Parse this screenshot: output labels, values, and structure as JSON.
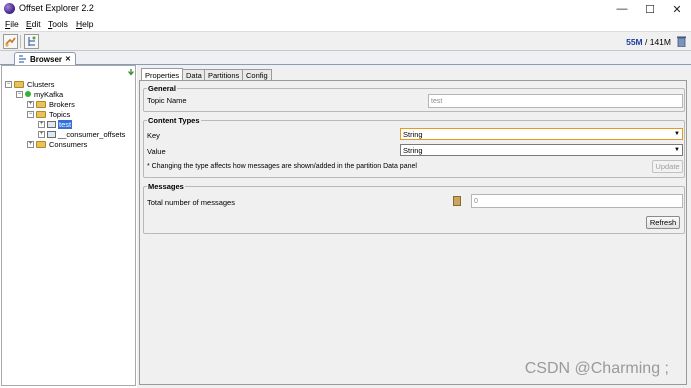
{
  "window": {
    "title": "Offset Explorer  2.2",
    "minimize": "—",
    "maximize": "☐",
    "close": "✕"
  },
  "menu": {
    "items": [
      {
        "accel": "F",
        "rest": "ile"
      },
      {
        "accel": "E",
        "rest": "dit"
      },
      {
        "accel": "T",
        "rest": "ools"
      },
      {
        "accel": "H",
        "rest": "elp"
      }
    ]
  },
  "toolbar": {
    "mem_used": "55M",
    "mem_total": " / 141M"
  },
  "browser_tab": {
    "label": "Browser",
    "close": "✕"
  },
  "tree": {
    "clusters": "Clusters",
    "cluster": "myKafka",
    "brokers": "Brokers",
    "topics": "Topics",
    "topic_selected": "test",
    "topic_other": "__consumer_offsets",
    "consumers": "Consumers",
    "expand_minus": "−",
    "expand_plus": "+"
  },
  "tabs": [
    "Properties",
    "Data",
    "Partitions",
    "Config"
  ],
  "general": {
    "legend": "General",
    "topic_name_label": "Topic Name",
    "topic_name_value": "test"
  },
  "content_types": {
    "legend": "Content Types",
    "key_label": "Key",
    "key_value": "String",
    "value_label": "Value",
    "value_value": "String",
    "note": "* Changing the type affects how messages are shown/added in the partition Data panel",
    "update": "Update",
    "arrow": "▼"
  },
  "messages": {
    "legend": "Messages",
    "total_label": "Total number of messages",
    "total_value": "0",
    "refresh": "Refresh"
  },
  "watermark": "CSDN @Charming ;"
}
